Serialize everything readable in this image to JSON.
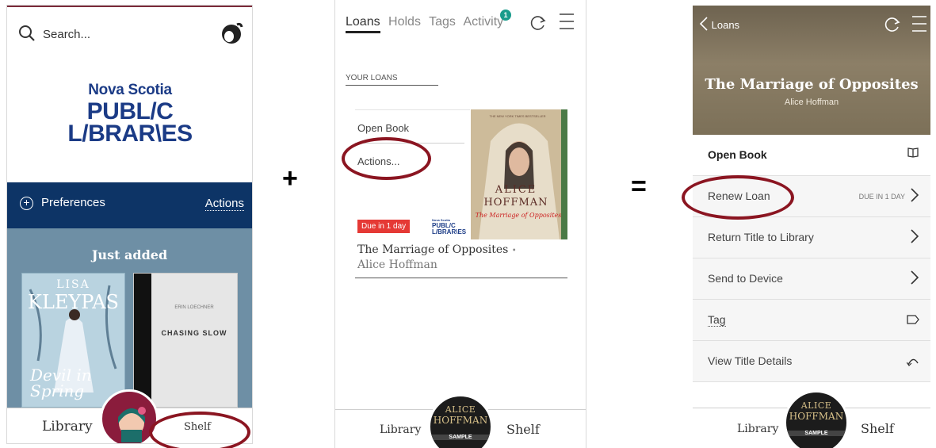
{
  "panel1": {
    "search_placeholder": "Search...",
    "logo": {
      "line1": "Nova Scotia",
      "line2": "PUBL/C",
      "line3": "L/BRAR\\ES"
    },
    "preferences_label": "Preferences",
    "actions_label": "Actions",
    "shelf_heading": "Just added",
    "books": [
      {
        "author": "LISA",
        "author2": "KLEYPAS",
        "title": "Devil in Spring"
      },
      {
        "author": "ERIN LOECHNER",
        "title": "CHASING SLOW"
      }
    ],
    "nav": {
      "library": "Library",
      "shelf": "Shelf"
    }
  },
  "operators": {
    "plus": "+",
    "equals": "="
  },
  "panel2": {
    "tabs": [
      "Loans",
      "Holds",
      "Tags",
      "Activity"
    ],
    "activity_badge": "1",
    "section_label": "YOUR LOANS",
    "menu": {
      "open_book": "Open Book",
      "actions": "Actions..."
    },
    "due_badge": "Due in 1 day",
    "mini_logo": {
      "line1": "Nova Scotia",
      "line2": "PUBL/C",
      "line3": "L/BRAR\\ES"
    },
    "cover": {
      "tagline": "THE NEW YORK TIMES BESTSELLER",
      "author1": "ALICE",
      "author2": "HOFFMAN",
      "title": "The Marriage of Opposites"
    },
    "book_title": "The Marriage of Opposites",
    "book_author": "Alice Hoffman",
    "nav": {
      "library": "Library",
      "shelf": "Shelf"
    },
    "sample_cover": {
      "line1": "ALICE",
      "line2": "HOFFMAN",
      "tag": "SAMPLE"
    }
  },
  "panel3": {
    "back_label": "Loans",
    "hero_title": "The Marriage of Opposites",
    "hero_author": "Alice Hoffman",
    "rows": [
      {
        "label": "Open Book"
      },
      {
        "label": "Renew Loan",
        "meta": "DUE IN 1 DAY"
      },
      {
        "label": "Return Title to Library"
      },
      {
        "label": "Send to Device"
      },
      {
        "label": "Tag"
      },
      {
        "label": "View Title Details"
      }
    ],
    "nav": {
      "library": "Library",
      "shelf": "Shelf"
    },
    "sample_cover": {
      "line1": "ALICE",
      "line2": "HOFFMAN",
      "tag": "SAMPLE"
    }
  },
  "colors": {
    "navy": "#0d3466",
    "logo_blue": "#1b3b86",
    "annotation_red": "#8b1521",
    "due_red": "#e53935",
    "badge_teal": "#1a9c8c"
  }
}
